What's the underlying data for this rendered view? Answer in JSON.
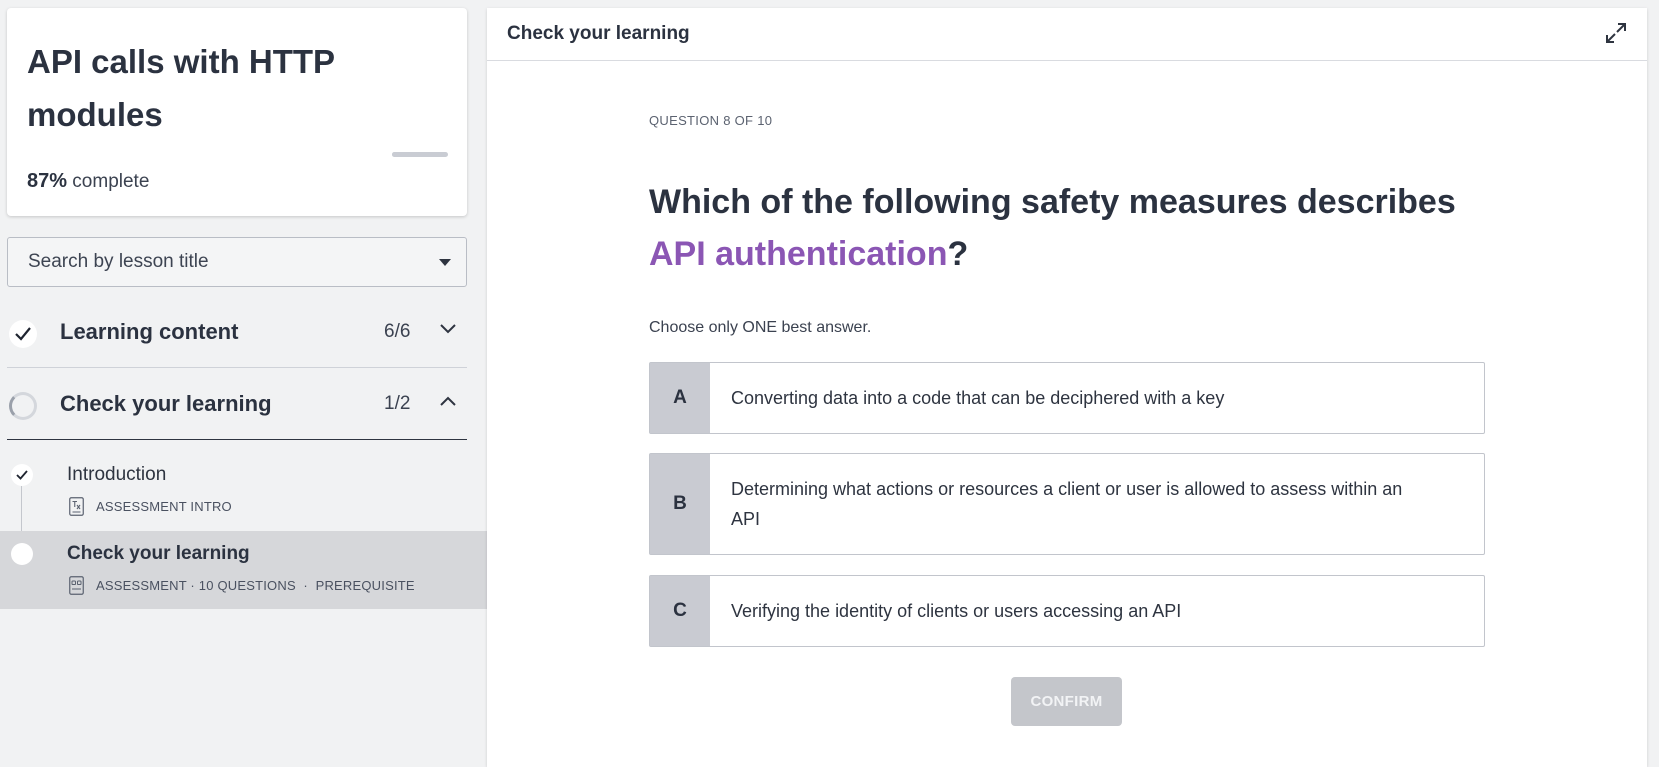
{
  "course": {
    "title": "API calls with HTTP modules",
    "progress_percent": 87,
    "progress_pct_label": "87%",
    "progress_suffix": " complete"
  },
  "search": {
    "placeholder": "Search by lesson title"
  },
  "sections": [
    {
      "title": "Learning content",
      "count": "6/6",
      "state": "complete",
      "expanded": false
    },
    {
      "title": "Check your learning",
      "count": "1/2",
      "state": "in-progress",
      "expanded": true
    }
  ],
  "lessons": [
    {
      "title": "Introduction",
      "meta": "ASSESSMENT INTRO",
      "state": "complete",
      "icon": "text-document-icon"
    },
    {
      "title": "Check your learning",
      "meta": "ASSESSMENT · 10 QUESTIONS  ·  PREREQUISITE",
      "state": "current",
      "icon": "assessment-icon"
    }
  ],
  "main": {
    "header_title": "Check your learning",
    "question_counter": "QUESTION 8 OF 10",
    "question_prefix": "Which of the following safety measures describes ",
    "question_highlight": "API authentication",
    "question_suffix": "?",
    "instruction": "Choose only ONE best answer.",
    "options": [
      {
        "letter": "A",
        "text": "Converting data into a code that can be deciphered with a key"
      },
      {
        "letter": "B",
        "text": "Determining what actions or resources a client or user is allowed to assess within an API"
      },
      {
        "letter": "C",
        "text": "Verifying the identity of clients or users accessing an API"
      }
    ],
    "confirm_label": "CONFIRM"
  },
  "colors": {
    "accent": "#8b56b4",
    "option_letter_bg": "#c9cbd2",
    "selected_lesson_bg": "#d6d7da",
    "confirm_disabled_bg": "#c4c6cb"
  }
}
